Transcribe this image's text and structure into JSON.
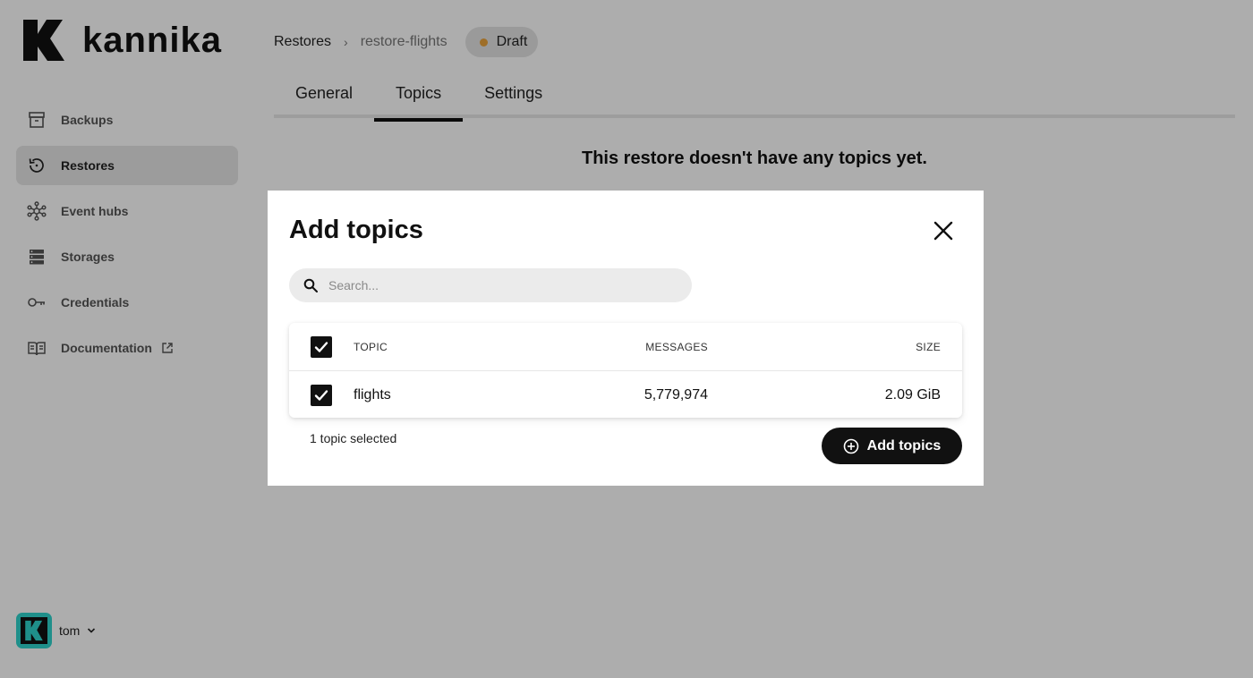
{
  "brand": {
    "name": "kannika",
    "accent": "#2fd3cc"
  },
  "sidebar": {
    "items": [
      {
        "label": "Backups",
        "icon": "archive-icon",
        "active": false
      },
      {
        "label": "Restores",
        "icon": "restore-icon",
        "active": true
      },
      {
        "label": "Event hubs",
        "icon": "hub-icon",
        "active": false
      },
      {
        "label": "Storages",
        "icon": "storage-icon",
        "active": false
      },
      {
        "label": "Credentials",
        "icon": "key-icon",
        "active": false
      },
      {
        "label": "Documentation",
        "icon": "book-icon",
        "active": false,
        "external": true
      }
    ],
    "user": {
      "name": "tom"
    }
  },
  "header": {
    "breadcrumb_root": "Restores",
    "breadcrumb_separator": "›",
    "breadcrumb_current": "restore-flights",
    "status": {
      "label": "Draft",
      "color": "#e9a23b"
    }
  },
  "tabs": [
    {
      "label": "General",
      "active": false
    },
    {
      "label": "Topics",
      "active": true
    },
    {
      "label": "Settings",
      "active": false
    }
  ],
  "main": {
    "empty_message": "This restore doesn't have any topics yet."
  },
  "modal": {
    "title": "Add topics",
    "search": {
      "placeholder": "Search...",
      "value": ""
    },
    "table": {
      "headers": {
        "topic": "TOPIC",
        "messages": "MESSAGES",
        "size": "SIZE"
      },
      "rows": [
        {
          "topic": "flights",
          "messages": "5,779,974",
          "size": "2.09 GiB",
          "checked": true
        }
      ]
    },
    "selected_text": "1 topic selected",
    "add_button": "Add topics"
  }
}
